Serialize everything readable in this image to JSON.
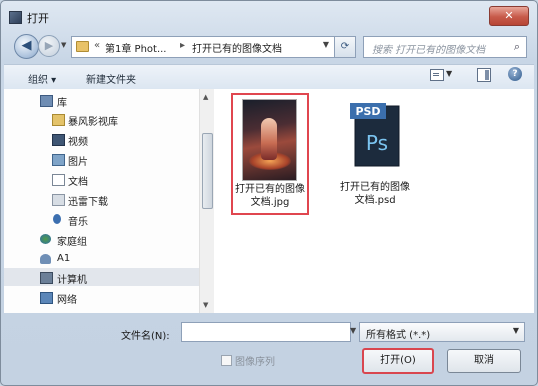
{
  "window": {
    "title": "打开",
    "close_label": "✕"
  },
  "nav": {
    "breadcrumb": [
      "第1章 Phot...",
      "打开已有的图像文档"
    ],
    "search_placeholder": "搜索 打开已有的图像文档"
  },
  "toolbar": {
    "organize": "组织 ▾",
    "new_folder": "新建文件夹",
    "help": "?"
  },
  "sidebar": {
    "items": [
      {
        "label": "库",
        "icon": "library-icon"
      },
      {
        "label": "暴风影视库",
        "icon": "video-library-icon"
      },
      {
        "label": "视频",
        "icon": "video-icon"
      },
      {
        "label": "图片",
        "icon": "pictures-icon"
      },
      {
        "label": "文档",
        "icon": "documents-icon"
      },
      {
        "label": "迅雷下载",
        "icon": "download-icon"
      },
      {
        "label": "音乐",
        "icon": "music-icon"
      },
      {
        "label": "家庭组",
        "icon": "homegroup-icon"
      },
      {
        "label": "A1",
        "icon": "user-icon"
      },
      {
        "label": "计算机",
        "icon": "computer-icon"
      },
      {
        "label": "网络",
        "icon": "network-icon"
      }
    ]
  },
  "files": [
    {
      "line1": "打开已有的图像",
      "line2": "文档.jpg",
      "type": "jpg",
      "selected": true
    },
    {
      "line1": "打开已有的图像",
      "line2": "文档.psd",
      "type": "psd",
      "badge": "PSD",
      "logo": "Ps"
    }
  ],
  "bottom": {
    "filename_label": "文件名(N):",
    "filename_value": "",
    "filetype_value": "所有格式 (*.*)",
    "sequence_label": "图像序列",
    "open_label": "打开(O)",
    "cancel_label": "取消"
  }
}
